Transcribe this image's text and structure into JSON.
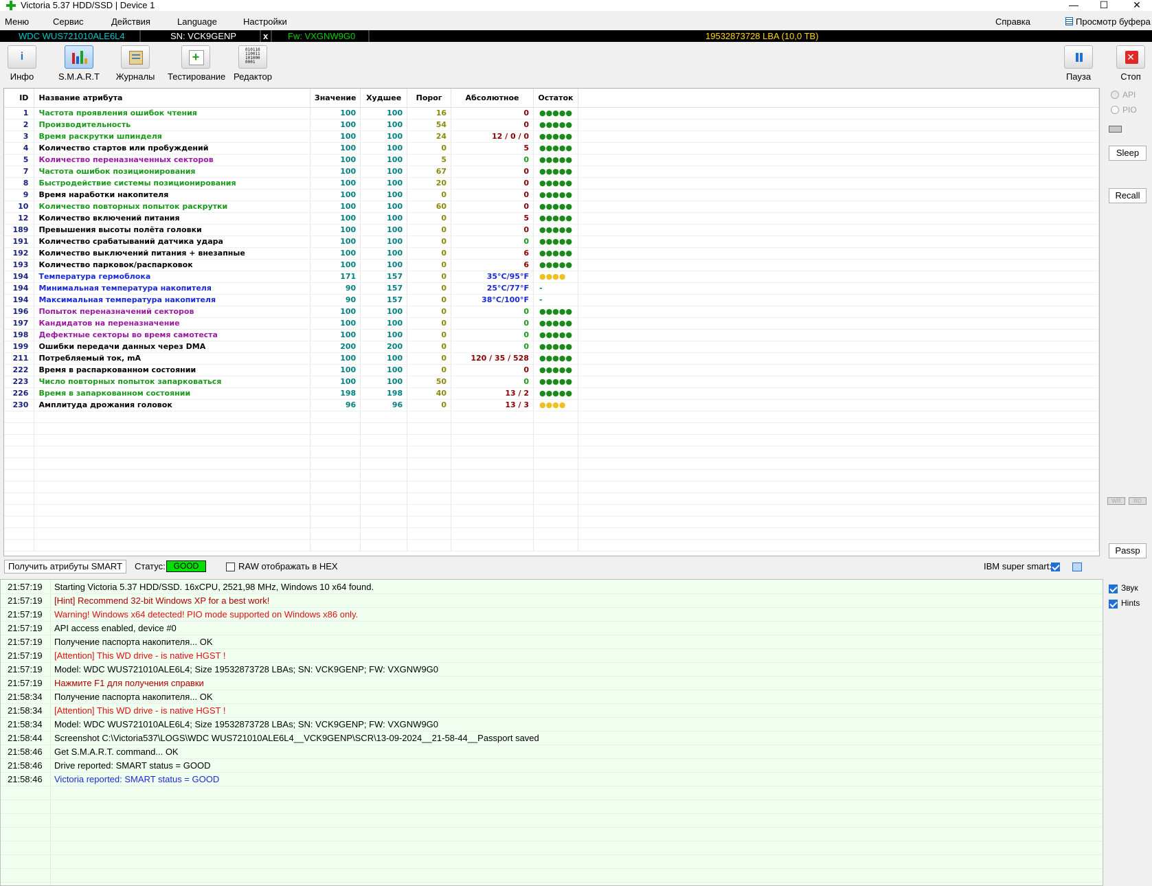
{
  "window": {
    "title": "Victoria 5.37 HDD/SSD | Device 1",
    "minimize": "—",
    "maximize": "☐",
    "close": "✕"
  },
  "menu": {
    "items": [
      "Меню",
      "Сервис",
      "Действия",
      "Language",
      "Настройки"
    ],
    "help": "Справка",
    "clipboard": "Просмотр буфера"
  },
  "drive": {
    "model": "WDC  WUS721010ALE6L4",
    "serial": "SN: VCK9GENP",
    "eject": "x",
    "firmware": "Fw: VXGNW9G0",
    "capacity": "19532873728 LBA (10,0 TB)",
    "colors": {
      "model": "#00c8c8",
      "serial": "#ffffff",
      "firmware": "#00d000",
      "capacity": "#ffd800"
    }
  },
  "toolbar": {
    "buttons": [
      {
        "label": "Инфо",
        "icon": "info-icon"
      },
      {
        "label": "S.M.A.R.T",
        "icon": "smart-chart-icon"
      },
      {
        "label": "Журналы",
        "icon": "journal-icon"
      },
      {
        "label": "Тестирование",
        "icon": "test-plus-icon"
      },
      {
        "label": "Редактор",
        "icon": "binary-editor-icon"
      }
    ],
    "pause": "Пауза",
    "stop": "Стоп",
    "editor_glyph": "010110 110011 101000 0001"
  },
  "smart": {
    "headers": [
      "ID",
      "Название атрибута",
      "Значение",
      "Худшее",
      "Порог",
      "Абсолютное",
      "Остаток"
    ],
    "colors": {
      "green": "#1a9a1a",
      "black": "#000000",
      "purple": "#9a1aa0",
      "blue": "#1a2ad6",
      "teal": "#008080",
      "olive": "#8a8a10",
      "darkred": "#8b0000",
      "dot_green": "#1a8a1a",
      "dot_yellow": "#f0c020"
    },
    "rows": [
      {
        "id": "1",
        "name": "Частота проявления ошибок чтения",
        "value": "100",
        "worst": "100",
        "threshold": "16",
        "raw": "0",
        "remain": "●●●●●",
        "nameColor": "green",
        "rawColor": "darkred",
        "remainColor": "dot_green"
      },
      {
        "id": "2",
        "name": "Производительность",
        "value": "100",
        "worst": "100",
        "threshold": "54",
        "raw": "0",
        "remain": "●●●●●",
        "nameColor": "green",
        "rawColor": "darkred",
        "remainColor": "dot_green"
      },
      {
        "id": "3",
        "name": "Время раскрутки шпинделя",
        "value": "100",
        "worst": "100",
        "threshold": "24",
        "raw": "12 / 0 / 0",
        "remain": "●●●●●",
        "nameColor": "green",
        "rawColor": "darkred",
        "remainColor": "dot_green"
      },
      {
        "id": "4",
        "name": "Количество стартов или пробуждений",
        "value": "100",
        "worst": "100",
        "threshold": "0",
        "raw": "5",
        "remain": "●●●●●",
        "nameColor": "black",
        "rawColor": "darkred",
        "remainColor": "dot_green"
      },
      {
        "id": "5",
        "name": "Количество переназначенных секторов",
        "value": "100",
        "worst": "100",
        "threshold": "5",
        "raw": "0",
        "remain": "●●●●●",
        "nameColor": "purple",
        "rawColor": "green",
        "remainColor": "dot_green"
      },
      {
        "id": "7",
        "name": "Частота ошибок позиционирования",
        "value": "100",
        "worst": "100",
        "threshold": "67",
        "raw": "0",
        "remain": "●●●●●",
        "nameColor": "green",
        "rawColor": "darkred",
        "remainColor": "dot_green"
      },
      {
        "id": "8",
        "name": "Быстродействие системы позиционирования",
        "value": "100",
        "worst": "100",
        "threshold": "20",
        "raw": "0",
        "remain": "●●●●●",
        "nameColor": "green",
        "rawColor": "darkred",
        "remainColor": "dot_green"
      },
      {
        "id": "9",
        "name": "Время наработки накопителя",
        "value": "100",
        "worst": "100",
        "threshold": "0",
        "raw": "0",
        "remain": "●●●●●",
        "nameColor": "black",
        "rawColor": "darkred",
        "remainColor": "dot_green"
      },
      {
        "id": "10",
        "name": "Количество повторных попыток раскрутки",
        "value": "100",
        "worst": "100",
        "threshold": "60",
        "raw": "0",
        "remain": "●●●●●",
        "nameColor": "green",
        "rawColor": "darkred",
        "remainColor": "dot_green"
      },
      {
        "id": "12",
        "name": "Количество включений питания",
        "value": "100",
        "worst": "100",
        "threshold": "0",
        "raw": "5",
        "remain": "●●●●●",
        "nameColor": "black",
        "rawColor": "darkred",
        "remainColor": "dot_green"
      },
      {
        "id": "189",
        "name": "Превышения высоты полёта головки",
        "value": "100",
        "worst": "100",
        "threshold": "0",
        "raw": "0",
        "remain": "●●●●●",
        "nameColor": "black",
        "rawColor": "darkred",
        "remainColor": "dot_green"
      },
      {
        "id": "191",
        "name": "Количество срабатываний датчика удара",
        "value": "100",
        "worst": "100",
        "threshold": "0",
        "raw": "0",
        "remain": "●●●●●",
        "nameColor": "black",
        "rawColor": "green",
        "remainColor": "dot_green"
      },
      {
        "id": "192",
        "name": "Количество выключений питания + внезапные",
        "value": "100",
        "worst": "100",
        "threshold": "0",
        "raw": "6",
        "remain": "●●●●●",
        "nameColor": "black",
        "rawColor": "darkred",
        "remainColor": "dot_green"
      },
      {
        "id": "193",
        "name": "Количество парковок/распарковок",
        "value": "100",
        "worst": "100",
        "threshold": "0",
        "raw": "6",
        "remain": "●●●●●",
        "nameColor": "black",
        "rawColor": "darkred",
        "remainColor": "dot_green"
      },
      {
        "id": "194",
        "name": "Температура гермоблока",
        "value": "171",
        "worst": "157",
        "threshold": "0",
        "raw": "35°C/95°F",
        "remain": "●●●●",
        "nameColor": "blue",
        "rawColor": "blue",
        "remainColor": "dot_yellow"
      },
      {
        "id": "194",
        "name": "Минимальная температура накопителя",
        "value": "90",
        "worst": "157",
        "threshold": "0",
        "raw": "25°C/77°F",
        "remain": "-",
        "nameColor": "blue",
        "rawColor": "blue",
        "remainColor": "teal"
      },
      {
        "id": "194",
        "name": "Максимальная температура накопителя",
        "value": "90",
        "worst": "157",
        "threshold": "0",
        "raw": "38°C/100°F",
        "remain": "-",
        "nameColor": "blue",
        "rawColor": "blue",
        "remainColor": "teal"
      },
      {
        "id": "196",
        "name": "Попыток переназначений секторов",
        "value": "100",
        "worst": "100",
        "threshold": "0",
        "raw": "0",
        "remain": "●●●●●",
        "nameColor": "purple",
        "rawColor": "green",
        "remainColor": "dot_green"
      },
      {
        "id": "197",
        "name": "Кандидатов на переназначение",
        "value": "100",
        "worst": "100",
        "threshold": "0",
        "raw": "0",
        "remain": "●●●●●",
        "nameColor": "purple",
        "rawColor": "green",
        "remainColor": "dot_green"
      },
      {
        "id": "198",
        "name": "Дефектные секторы во время самотеста",
        "value": "100",
        "worst": "100",
        "threshold": "0",
        "raw": "0",
        "remain": "●●●●●",
        "nameColor": "purple",
        "rawColor": "green",
        "remainColor": "dot_green"
      },
      {
        "id": "199",
        "name": "Ошибки передачи данных через DMA",
        "value": "200",
        "worst": "200",
        "threshold": "0",
        "raw": "0",
        "remain": "●●●●●",
        "nameColor": "black",
        "rawColor": "green",
        "remainColor": "dot_green"
      },
      {
        "id": "211",
        "name": "Потребляемый ток, mA",
        "value": "100",
        "worst": "100",
        "threshold": "0",
        "raw": "120 / 35 / 528",
        "remain": "●●●●●",
        "nameColor": "black",
        "rawColor": "darkred",
        "remainColor": "dot_green"
      },
      {
        "id": "222",
        "name": "Время в распаркованном состоянии",
        "value": "100",
        "worst": "100",
        "threshold": "0",
        "raw": "0",
        "remain": "●●●●●",
        "nameColor": "black",
        "rawColor": "darkred",
        "remainColor": "dot_green"
      },
      {
        "id": "223",
        "name": "Число повторных попыток запарковаться",
        "value": "100",
        "worst": "100",
        "threshold": "50",
        "raw": "0",
        "remain": "●●●●●",
        "nameColor": "green",
        "rawColor": "green",
        "remainColor": "dot_green"
      },
      {
        "id": "226",
        "name": "Время в запаркованном состоянии",
        "value": "198",
        "worst": "198",
        "threshold": "40",
        "raw": "13 / 2",
        "remain": "●●●●●",
        "nameColor": "green",
        "rawColor": "darkred",
        "remainColor": "dot_green"
      },
      {
        "id": "230",
        "name": "Амплитуда дрожания головок",
        "value": "96",
        "worst": "96",
        "threshold": "0",
        "raw": "13 / 3",
        "remain": "●●●●",
        "nameColor": "black",
        "rawColor": "darkred",
        "remainColor": "dot_yellow"
      }
    ]
  },
  "smart_footer": {
    "get_button": "Получить атрибуты SMART",
    "status_label": "Статус:",
    "status_value": "GOOD",
    "raw_hex_label": "RAW отображать в HEX",
    "ibm_label": "IBM super smart:"
  },
  "side": {
    "api": "API",
    "pio": "PIO",
    "sleep": "Sleep",
    "recall": "Recall",
    "wr": "WR",
    "rd": "RD",
    "passp": "Passp",
    "sound": "Звук",
    "hints": "Hints"
  },
  "log": {
    "colors": {
      "normal": "#000000",
      "red": "#e01010",
      "darkred": "#b00000",
      "blue": "#1a2ad6"
    },
    "entries": [
      {
        "time": "21:57:19",
        "msg": "Starting Victoria 5.37 HDD/SSD. 16xCPU, 2521,98 MHz, Windows 10 x64 found.",
        "color": "normal"
      },
      {
        "time": "21:57:19",
        "msg": "[Hint] Recommend 32-bit Windows XP for a best work!",
        "color": "darkred"
      },
      {
        "time": "21:57:19",
        "msg": "Warning! Windows x64 detected! PIO mode supported on Windows x86 only.",
        "color": "red"
      },
      {
        "time": "21:57:19",
        "msg": "API access enabled, device #0",
        "color": "normal"
      },
      {
        "time": "21:57:19",
        "msg": "Получение паспорта накопителя... OK",
        "color": "normal"
      },
      {
        "time": "21:57:19",
        "msg": "[Attention] This WD drive - is native HGST !",
        "color": "red"
      },
      {
        "time": "21:57:19",
        "msg": "Model: WDC  WUS721010ALE6L4; Size 19532873728 LBAs; SN: VCK9GENP; FW: VXGNW9G0",
        "color": "normal"
      },
      {
        "time": "21:57:19",
        "msg": "Нажмите F1 для получения справки",
        "color": "darkred"
      },
      {
        "time": "21:58:34",
        "msg": "Получение паспорта накопителя... OK",
        "color": "normal"
      },
      {
        "time": "21:58:34",
        "msg": "[Attention] This WD drive - is native HGST !",
        "color": "red"
      },
      {
        "time": "21:58:34",
        "msg": "Model: WDC  WUS721010ALE6L4; Size 19532873728 LBAs; SN: VCK9GENP; FW: VXGNW9G0",
        "color": "normal"
      },
      {
        "time": "21:58:44",
        "msg": "Screenshot C:\\Victoria537\\LOGS\\WDC  WUS721010ALE6L4__VCK9GENP\\SCR\\13-09-2024__21-58-44__Passport saved",
        "color": "normal"
      },
      {
        "time": "21:58:46",
        "msg": "Get S.M.A.R.T. command... OK",
        "color": "normal"
      },
      {
        "time": "21:58:46",
        "msg": "Drive reported: SMART status = GOOD",
        "color": "normal"
      },
      {
        "time": "21:58:46",
        "msg": "Victoria reported: SMART status = GOOD",
        "color": "blue"
      }
    ]
  }
}
